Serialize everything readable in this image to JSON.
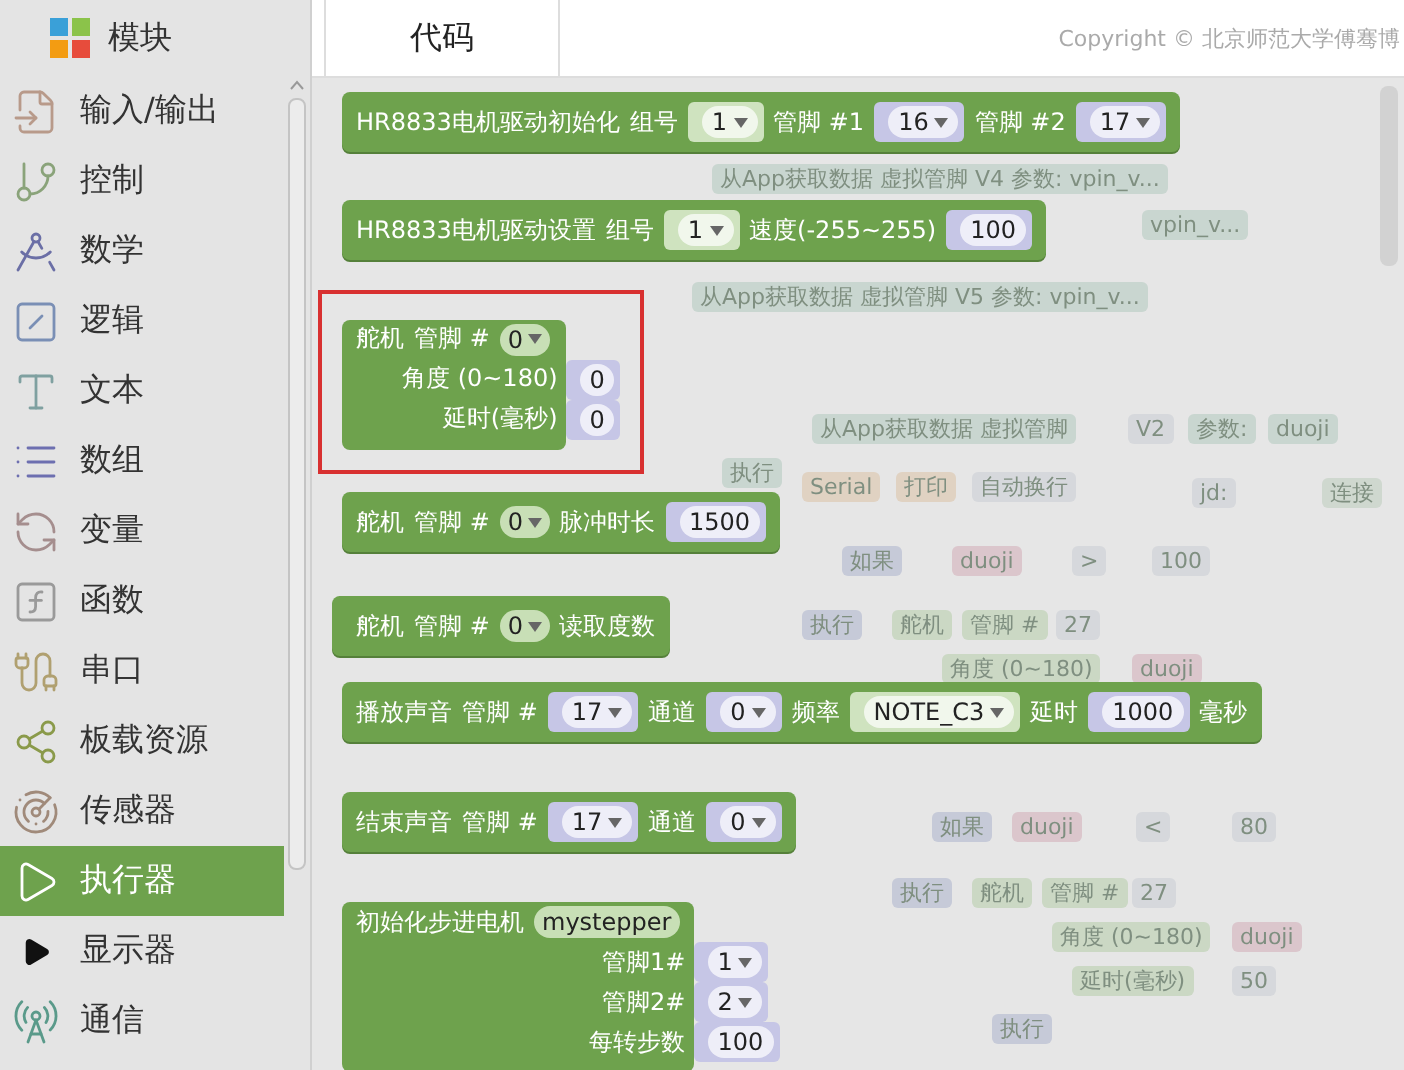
{
  "sidebar": {
    "title": "模块",
    "items": [
      {
        "label": "输入/输出",
        "selected": false
      },
      {
        "label": "控制",
        "selected": false
      },
      {
        "label": "数学",
        "selected": false
      },
      {
        "label": "逻辑",
        "selected": false
      },
      {
        "label": "文本",
        "selected": false
      },
      {
        "label": "数组",
        "selected": false
      },
      {
        "label": "变量",
        "selected": false
      },
      {
        "label": "函数",
        "selected": false
      },
      {
        "label": "串口",
        "selected": false
      },
      {
        "label": "板载资源",
        "selected": false
      },
      {
        "label": "传感器",
        "selected": false
      },
      {
        "label": "执行器",
        "selected": true
      },
      {
        "label": "显示器",
        "selected": false
      },
      {
        "label": "通信",
        "selected": false
      }
    ]
  },
  "tabs": [
    {
      "label": "代码",
      "selected": true
    }
  ],
  "copyright": "Copyright © 北京师范大学傅骞博",
  "flyout_blocks": [
    {
      "kind": "row",
      "highlighted": false,
      "parts": [
        {
          "kind": "label",
          "text": "HR8833电机驱动初始化"
        },
        {
          "kind": "label",
          "text": "组号"
        },
        {
          "kind": "socket",
          "text": "1",
          "dropdown": true,
          "color": "#cfe3bf"
        },
        {
          "kind": "label",
          "text": "管脚 #1"
        },
        {
          "kind": "socket",
          "text": "16",
          "dropdown": true,
          "color": "#c6c6e6"
        },
        {
          "kind": "label",
          "text": "管脚 #2"
        },
        {
          "kind": "socket",
          "text": "17",
          "dropdown": true,
          "color": "#c6c6e6"
        }
      ]
    },
    {
      "kind": "row",
      "highlighted": false,
      "parts": [
        {
          "kind": "label",
          "text": "HR8833电机驱动设置"
        },
        {
          "kind": "label",
          "text": "组号"
        },
        {
          "kind": "socket",
          "text": "1",
          "dropdown": true,
          "color": "#cfe3bf"
        },
        {
          "kind": "label",
          "text": "速度(-255~255)"
        },
        {
          "kind": "socket",
          "text": "100",
          "dropdown": false,
          "color": "#c6c6e6"
        }
      ]
    },
    {
      "kind": "stack",
      "highlighted": true,
      "parts": [
        {
          "kind": "label",
          "text": "舵机"
        },
        {
          "kind": "label",
          "text": "管脚 #"
        },
        {
          "kind": "field",
          "text": "0",
          "dropdown": true
        }
      ],
      "rows": [
        {
          "label": "角度 (0~180)",
          "input": {
            "kind": "socket",
            "text": "0",
            "dropdown": false,
            "color": "#c6c6e6"
          }
        },
        {
          "label": "延时(毫秒)",
          "input": {
            "kind": "socket",
            "text": "0",
            "dropdown": false,
            "color": "#c6c6e6"
          }
        }
      ]
    },
    {
      "kind": "row",
      "highlighted": false,
      "parts": [
        {
          "kind": "label",
          "text": "舵机"
        },
        {
          "kind": "label",
          "text": "管脚 #"
        },
        {
          "kind": "field",
          "text": "0",
          "dropdown": true
        },
        {
          "kind": "label",
          "text": "脉冲时长"
        },
        {
          "kind": "socket",
          "text": "1500",
          "dropdown": false,
          "color": "#c6c6e6"
        }
      ]
    },
    {
      "kind": "value",
      "highlighted": false,
      "parts": [
        {
          "kind": "label",
          "text": "舵机"
        },
        {
          "kind": "label",
          "text": "管脚 #"
        },
        {
          "kind": "field",
          "text": "0",
          "dropdown": true
        },
        {
          "kind": "label",
          "text": "读取度数"
        }
      ]
    },
    {
      "kind": "row",
      "highlighted": false,
      "parts": [
        {
          "kind": "label",
          "text": "播放声音"
        },
        {
          "kind": "label",
          "text": "管脚 #"
        },
        {
          "kind": "socket",
          "text": "17",
          "dropdown": true,
          "color": "#c6c6e6"
        },
        {
          "kind": "label",
          "text": "通道"
        },
        {
          "kind": "socket",
          "text": "0",
          "dropdown": true,
          "color": "#c6c6e6"
        },
        {
          "kind": "label",
          "text": "频率"
        },
        {
          "kind": "socket",
          "text": "NOTE_C3",
          "dropdown": true,
          "color": "#cfe3bf"
        },
        {
          "kind": "label",
          "text": "延时"
        },
        {
          "kind": "socket",
          "text": "1000",
          "dropdown": false,
          "color": "#c6c6e6"
        },
        {
          "kind": "label",
          "text": "毫秒"
        }
      ]
    },
    {
      "kind": "row",
      "highlighted": false,
      "parts": [
        {
          "kind": "label",
          "text": "结束声音"
        },
        {
          "kind": "label",
          "text": "管脚 #"
        },
        {
          "kind": "socket",
          "text": "17",
          "dropdown": true,
          "color": "#c6c6e6"
        },
        {
          "kind": "label",
          "text": "通道"
        },
        {
          "kind": "socket",
          "text": "0",
          "dropdown": true,
          "color": "#c6c6e6"
        }
      ]
    },
    {
      "kind": "stack",
      "highlighted": false,
      "parts": [
        {
          "kind": "label",
          "text": "初始化步进电机"
        },
        {
          "kind": "field",
          "text": "mystepper",
          "dropdown": false
        }
      ],
      "rows": [
        {
          "label": "管脚1#",
          "input": {
            "kind": "socket",
            "text": "1",
            "dropdown": true,
            "color": "#c6c6e6"
          }
        },
        {
          "label": "管脚2#",
          "input": {
            "kind": "socket",
            "text": "2",
            "dropdown": true,
            "color": "#c6c6e6"
          }
        },
        {
          "label": "每转步数",
          "input": {
            "kind": "socket",
            "text": "100",
            "dropdown": false,
            "color": "#c6c6e6"
          }
        }
      ]
    }
  ],
  "workspace_blocks": [
    {
      "kind": "event",
      "text": "从App获取数据 虚拟管脚 V4 参数:  vpin_v..."
    },
    {
      "kind": "event",
      "text": "vpin_v..."
    },
    {
      "kind": "event",
      "text": "从App获取数据 虚拟管脚 V5 参数:  vpin_v..."
    },
    {
      "kind": "event",
      "text": "从App获取数据 虚拟管脚"
    },
    {
      "kind": "value",
      "text": "V2"
    },
    {
      "kind": "event",
      "text": "参数:"
    },
    {
      "kind": "event",
      "text": "duoji"
    },
    {
      "kind": "event",
      "text": "执行"
    },
    {
      "kind": "serial",
      "text": "Serial"
    },
    {
      "kind": "serial",
      "text": "打印"
    },
    {
      "kind": "value",
      "text": "自动换行"
    },
    {
      "kind": "value",
      "text": "jd:"
    },
    {
      "kind": "text",
      "text": "连接"
    },
    {
      "kind": "logic",
      "text": "如果"
    },
    {
      "kind": "variable",
      "text": "duoji"
    },
    {
      "kind": "value",
      "text": ">"
    },
    {
      "kind": "value",
      "text": "100"
    },
    {
      "kind": "logic",
      "text": "执行"
    },
    {
      "kind": "statement",
      "text": "舵机"
    },
    {
      "kind": "statement",
      "text": "管脚 #"
    },
    {
      "kind": "value",
      "text": "27"
    },
    {
      "kind": "statement",
      "text": "角度 (0~180)"
    },
    {
      "kind": "variable",
      "text": "duoji"
    },
    {
      "kind": "logic",
      "text": "如果"
    },
    {
      "kind": "variable",
      "text": "duoji"
    },
    {
      "kind": "value",
      "text": "<"
    },
    {
      "kind": "value",
      "text": "80"
    },
    {
      "kind": "logic",
      "text": "执行"
    },
    {
      "kind": "statement",
      "text": "舵机"
    },
    {
      "kind": "statement",
      "text": "管脚 #"
    },
    {
      "kind": "value",
      "text": "27"
    },
    {
      "kind": "statement",
      "text": "角度 (0~180)"
    },
    {
      "kind": "variable",
      "text": "duoji"
    },
    {
      "kind": "statement",
      "text": "延时(毫秒)"
    },
    {
      "kind": "value",
      "text": "50"
    },
    {
      "kind": "logic",
      "text": "执行"
    }
  ]
}
